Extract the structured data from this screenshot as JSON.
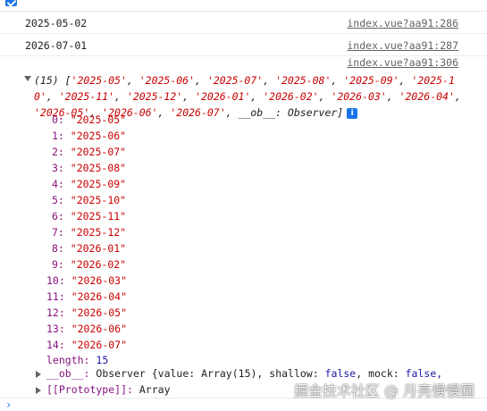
{
  "header": {
    "label": ""
  },
  "logs": [
    {
      "message": "2025-05-02",
      "source": "index.vue?aa91:286"
    },
    {
      "message": "2026-07-01",
      "source": "index.vue?aa91:287"
    },
    {
      "message": "",
      "source": "index.vue?aa91:306"
    }
  ],
  "array_log": {
    "count": "(15)",
    "preview_items": [
      "'2025-05'",
      "'2025-06'",
      "'2025-07'",
      "'2025-08'",
      "'2025-09'",
      "'2025-10'",
      "'2025-11'",
      "'2025-12'",
      "'2026-01'",
      "'2026-02'",
      "'2026-03'",
      "'2026-04'",
      "'2026-05'",
      "'2026-06'",
      "'2026-07'"
    ],
    "preview_tail": "__ob__: Observer]",
    "items": [
      {
        "index": "0:",
        "value": "\"2025-05\""
      },
      {
        "index": "1:",
        "value": "\"2025-06\""
      },
      {
        "index": "2:",
        "value": "\"2025-07\""
      },
      {
        "index": "3:",
        "value": "\"2025-08\""
      },
      {
        "index": "4:",
        "value": "\"2025-09\""
      },
      {
        "index": "5:",
        "value": "\"2025-10\""
      },
      {
        "index": "6:",
        "value": "\"2025-11\""
      },
      {
        "index": "7:",
        "value": "\"2025-12\""
      },
      {
        "index": "8:",
        "value": "\"2026-01\""
      },
      {
        "index": "9:",
        "value": "\"2026-02\""
      },
      {
        "index": "10:",
        "value": "\"2026-03\""
      },
      {
        "index": "11:",
        "value": "\"2026-04\""
      },
      {
        "index": "12:",
        "value": "\"2026-05\""
      },
      {
        "index": "13:",
        "value": "\"2026-06\""
      },
      {
        "index": "14:",
        "value": "\"2026-07\""
      }
    ],
    "length_label": "length:",
    "length_value": "15",
    "ob_key": "__ob__:",
    "ob_value": "Observer {value: Array(15), shallow:",
    "ob_shallow": "false",
    "ob_mock_key": ", mock:",
    "ob_mock": "false,",
    "proto_key": "[[Prototype]]:",
    "proto_value": "Array"
  },
  "prompt": "›",
  "watermark": "掘金技术社区 @ 月亮慢慢圆"
}
